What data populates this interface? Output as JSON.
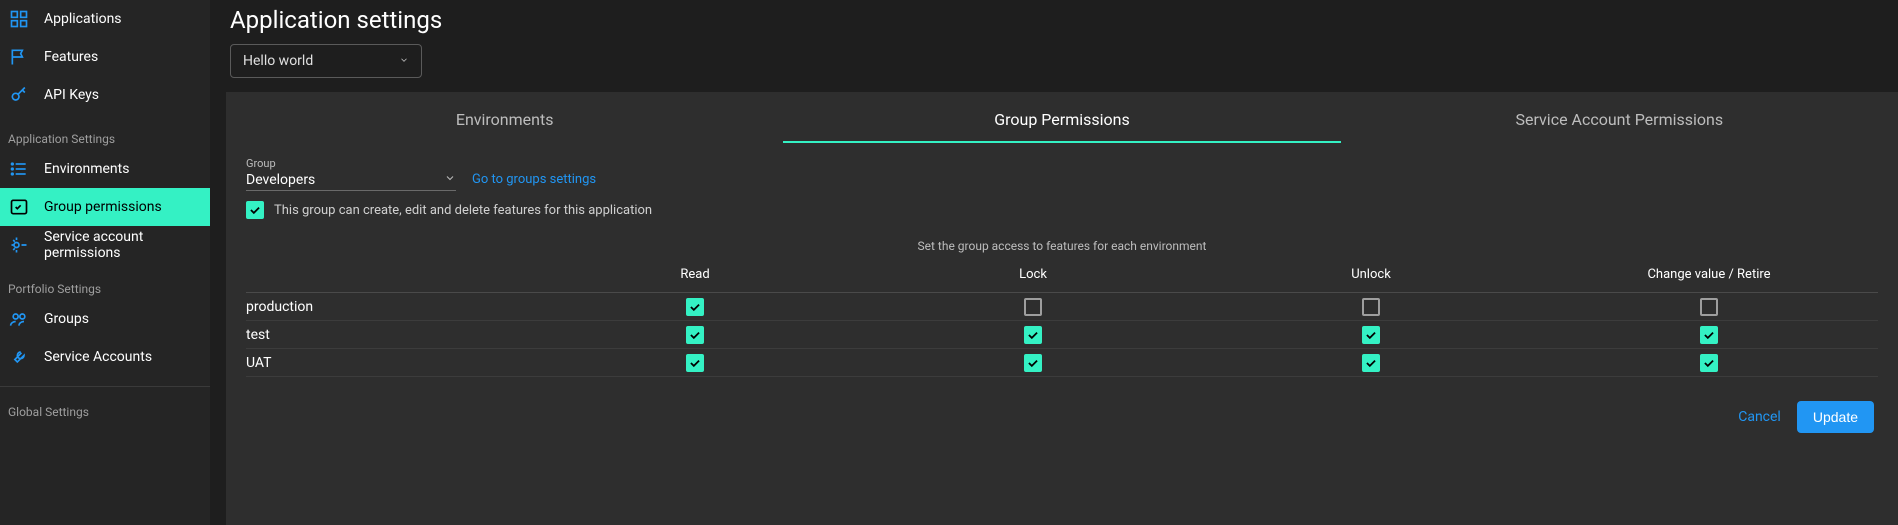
{
  "sidebar": {
    "top": [
      {
        "label": "Applications",
        "icon": "apps"
      },
      {
        "label": "Features",
        "icon": "flag"
      },
      {
        "label": "API Keys",
        "icon": "key"
      }
    ],
    "section_app_label": "Application Settings",
    "app_settings": [
      {
        "label": "Environments",
        "icon": "list"
      },
      {
        "label": "Group permissions",
        "icon": "checkbox-list",
        "active": true
      },
      {
        "label": "Service account permissions",
        "icon": "gear-key"
      }
    ],
    "section_portfolio_label": "Portfolio Settings",
    "portfolio_settings": [
      {
        "label": "Groups",
        "icon": "users"
      },
      {
        "label": "Service Accounts",
        "icon": "wrench"
      }
    ],
    "section_global_label": "Global Settings"
  },
  "header": {
    "title": "Application settings",
    "app_selected": "Hello world"
  },
  "tabs": [
    {
      "label": "Environments"
    },
    {
      "label": "Group Permissions",
      "active": true
    },
    {
      "label": "Service Account Permissions"
    }
  ],
  "group": {
    "label": "Group",
    "selected": "Developers",
    "link": "Go to groups settings",
    "feature_perm_label": "This group can create, edit and delete features for this application",
    "feature_perm_checked": true
  },
  "helper_text": "Set the group access to features for each environment",
  "table": {
    "columns": [
      "",
      "Read",
      "Lock",
      "Unlock",
      "Change value / Retire"
    ],
    "rows": [
      {
        "env": "production",
        "perms": [
          true,
          false,
          false,
          false
        ]
      },
      {
        "env": "test",
        "perms": [
          true,
          true,
          true,
          true
        ]
      },
      {
        "env": "UAT",
        "perms": [
          true,
          true,
          true,
          true
        ]
      }
    ]
  },
  "footer": {
    "cancel": "Cancel",
    "update": "Update"
  }
}
